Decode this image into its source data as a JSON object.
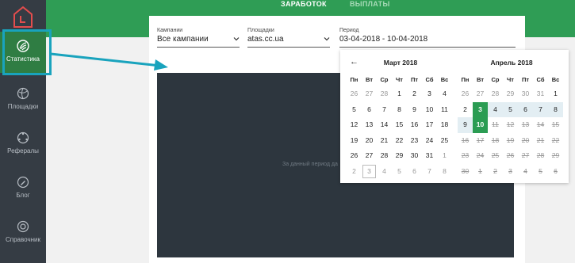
{
  "tabs": {
    "earnings": "ЗАРАБОТОК",
    "payouts": "ВЫПЛАТЫ"
  },
  "sidebar": {
    "items": [
      {
        "label": "Статистика",
        "icon": "chart-leaf-icon",
        "active": true
      },
      {
        "label": "Площадки",
        "icon": "globe-icon"
      },
      {
        "label": "Рефералы",
        "icon": "network-icon"
      },
      {
        "label": "Блог",
        "icon": "pencil-icon"
      },
      {
        "label": "Справочник",
        "icon": "lifebuoy-icon"
      }
    ]
  },
  "filters": {
    "campaigns": {
      "label": "Кампании",
      "value": "Все кампании"
    },
    "sites": {
      "label": "Площадки",
      "value": "atas.cc.ua"
    },
    "period": {
      "label": "Период",
      "value": "03-04-2018 - 10-04-2018"
    }
  },
  "empty_message": "За данный период да",
  "calendar": {
    "prev_arrow": "←",
    "weekdays": [
      "Пн",
      "Вт",
      "Ср",
      "Чт",
      "Пт",
      "Сб",
      "Вс"
    ],
    "march": {
      "title": "Март 2018",
      "rows": [
        [
          "26",
          "27",
          "28",
          "1",
          "2",
          "3",
          "4"
        ],
        [
          "5",
          "6",
          "7",
          "8",
          "9",
          "10",
          "11"
        ],
        [
          "12",
          "13",
          "14",
          "15",
          "16",
          "17",
          "18"
        ],
        [
          "19",
          "20",
          "21",
          "22",
          "23",
          "24",
          "25"
        ],
        [
          "26",
          "27",
          "28",
          "29",
          "30",
          "31",
          "1"
        ],
        [
          "2",
          "3",
          "4",
          "5",
          "6",
          "7",
          "8"
        ]
      ]
    },
    "april": {
      "title": "Апрель 2018",
      "rows": [
        [
          "26",
          "27",
          "28",
          "29",
          "30",
          "31",
          "1"
        ],
        [
          "2",
          "3",
          "4",
          "5",
          "6",
          "7",
          "8"
        ],
        [
          "9",
          "10",
          "11",
          "12",
          "13",
          "14",
          "15"
        ],
        [
          "16",
          "17",
          "18",
          "19",
          "20",
          "21",
          "22"
        ],
        [
          "23",
          "24",
          "25",
          "26",
          "27",
          "28",
          "29"
        ],
        [
          "30",
          "1",
          "2",
          "3",
          "4",
          "5",
          "6"
        ]
      ]
    }
  },
  "colors": {
    "green": "#2f9d55",
    "sidebar": "#353c44",
    "selected": "#2b9c53",
    "highlight": "#19a3bd"
  }
}
